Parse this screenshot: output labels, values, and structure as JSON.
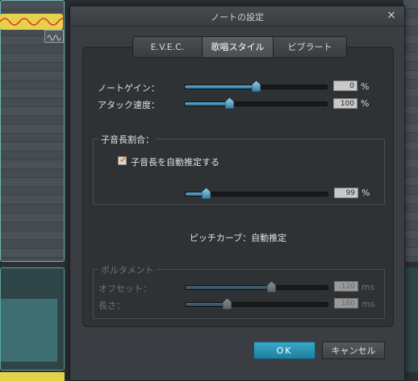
{
  "dialog": {
    "title": "ノートの設定",
    "close_label": "×"
  },
  "tabs": [
    {
      "label": "E.V.E.C.",
      "active": false
    },
    {
      "label": "歌唱スタイル",
      "active": true
    },
    {
      "label": "ビブラート",
      "active": false
    }
  ],
  "params": {
    "note_gain": {
      "label": "ノートゲイン：",
      "value": "0",
      "unit": "%",
      "level": 0.5
    },
    "attack_speed": {
      "label": "アタック速度：",
      "value": "100",
      "unit": "%",
      "level": 0.31
    }
  },
  "consonant": {
    "group_title": "子音長割合：",
    "auto_checkbox_label": "子音長を自動推定する",
    "auto_checked": true,
    "value": "99",
    "unit": "%",
    "level": 0.14
  },
  "pitch_curve": "ピッチカーブ：自動推定",
  "portamento": {
    "group_title": "ポルタメント",
    "enabled": false,
    "offset": {
      "label": "オフセット：",
      "value": "-120",
      "unit": "ms",
      "level": 0.6
    },
    "length": {
      "label": "長さ：",
      "value": "180",
      "unit": "ms",
      "level": 0.29
    }
  },
  "buttons": {
    "ok": "OK",
    "cancel": "キャンセル"
  },
  "colors": {
    "accent": "#2d93b8",
    "checkmark": "#e0761b",
    "note_bar": "#e6d24a"
  }
}
